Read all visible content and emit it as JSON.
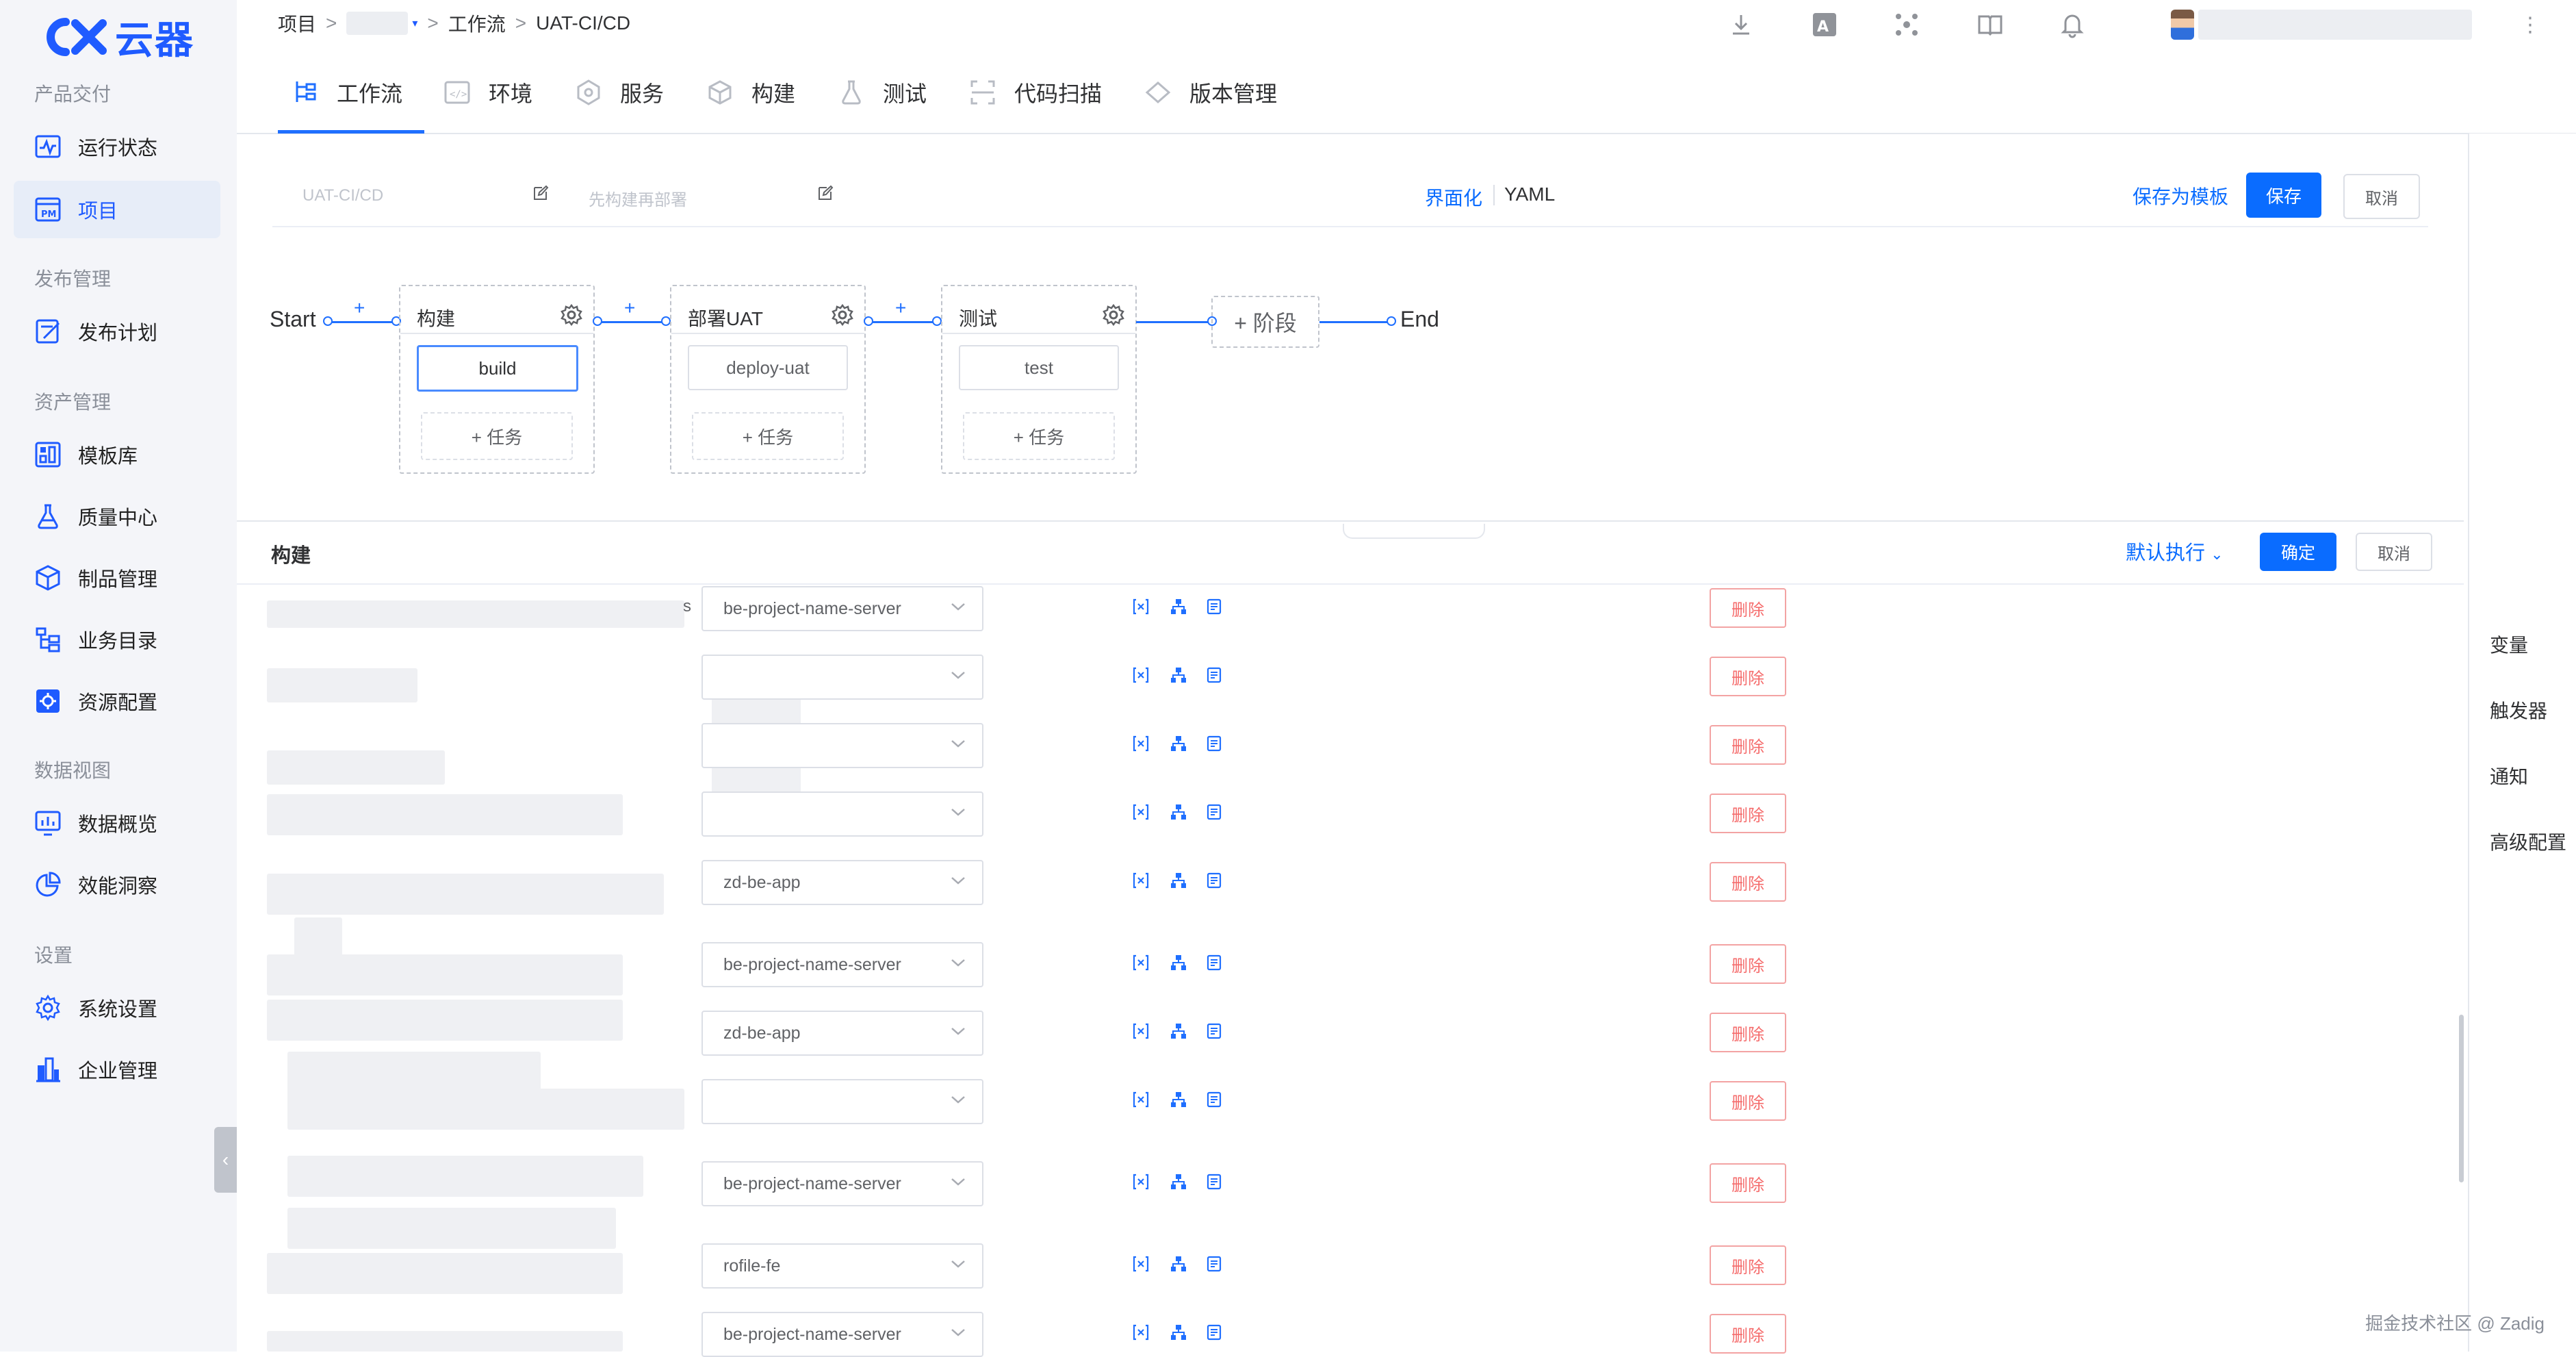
{
  "brand": {
    "name": "云器",
    "color": "#1f5bff"
  },
  "colors": {
    "primary": "#0a6cff",
    "danger": "#f56c6c",
    "sidebar_bg": "#f4f5f9",
    "active_bg": "#e7edf8"
  },
  "sidebar": {
    "sections": [
      {
        "title": "产品交付",
        "items": [
          {
            "label": "运行状态",
            "icon": "activity-monitor-icon"
          },
          {
            "label": "项目",
            "icon": "project-pm-icon",
            "active": true
          }
        ]
      },
      {
        "title": "发布管理",
        "items": [
          {
            "label": "发布计划",
            "icon": "release-plan-icon"
          }
        ]
      },
      {
        "title": "资产管理",
        "items": [
          {
            "label": "模板库",
            "icon": "template-library-icon"
          },
          {
            "label": "质量中心",
            "icon": "flask-icon"
          },
          {
            "label": "制品管理",
            "icon": "artifact-box-icon"
          },
          {
            "label": "业务目录",
            "icon": "catalog-tree-icon"
          },
          {
            "label": "资源配置",
            "icon": "resource-gear-icon"
          }
        ]
      },
      {
        "title": "数据视图",
        "items": [
          {
            "label": "数据概览",
            "icon": "bar-chart-icon"
          },
          {
            "label": "效能洞察",
            "icon": "pie-chart-icon"
          }
        ]
      },
      {
        "title": "设置",
        "items": [
          {
            "label": "系统设置",
            "icon": "settings-gear-icon"
          },
          {
            "label": "企业管理",
            "icon": "enterprise-building-icon"
          }
        ]
      }
    ],
    "collapse_glyph": "‹"
  },
  "breadcrumb": {
    "root": "项目",
    "sep": ">",
    "level2": "工作流",
    "current": "UAT-CI/CD"
  },
  "tabs": [
    {
      "label": "工作流",
      "icon": "workflow-icon",
      "active": true
    },
    {
      "label": "环境",
      "icon": "environment-code-icon"
    },
    {
      "label": "服务",
      "icon": "service-hex-icon"
    },
    {
      "label": "构建",
      "icon": "build-cube-icon"
    },
    {
      "label": "测试",
      "icon": "test-flask-icon"
    },
    {
      "label": "代码扫描",
      "icon": "code-scan-icon"
    },
    {
      "label": "版本管理",
      "icon": "version-tag-icon"
    }
  ],
  "toolbar": {
    "workflow_name": "UAT-CI/CD",
    "description": "先构建再部署",
    "mode_ui": "界面化",
    "mode_yaml": "YAML",
    "save_template": "保存为模板",
    "save": "保存",
    "cancel": "取消"
  },
  "pipeline": {
    "start": "Start",
    "end": "End",
    "add_stage": "+ 阶段",
    "plus": "+",
    "stages": [
      {
        "name": "构建",
        "job": "build",
        "add_task": "+ 任务"
      },
      {
        "name": "部署UAT",
        "job": "deploy-uat",
        "add_task": "+ 任务"
      },
      {
        "name": "测试",
        "job": "test",
        "add_task": "+ 任务"
      }
    ]
  },
  "build_panel": {
    "title": "构建",
    "default_exec": "默认执行",
    "confirm": "确定",
    "cancel": "取消",
    "delete_label": "删除",
    "name_suffix_s": "s",
    "rows": [
      {
        "service": "be-project-name-server"
      },
      {
        "service": ""
      },
      {
        "service": ""
      },
      {
        "service": ""
      },
      {
        "service": "zd-be-app"
      },
      {
        "service": "be-project-name-server"
      },
      {
        "service": "zd-be-app"
      },
      {
        "service": ""
      },
      {
        "service": "be-project-name-server"
      },
      {
        "service": "rofile-fe"
      },
      {
        "service": "be-project-name-server"
      }
    ]
  },
  "right_panel": {
    "items": [
      "变量",
      "触发器",
      "通知",
      "高级配置"
    ]
  },
  "watermark": "掘金技术社区 @ Zadig"
}
